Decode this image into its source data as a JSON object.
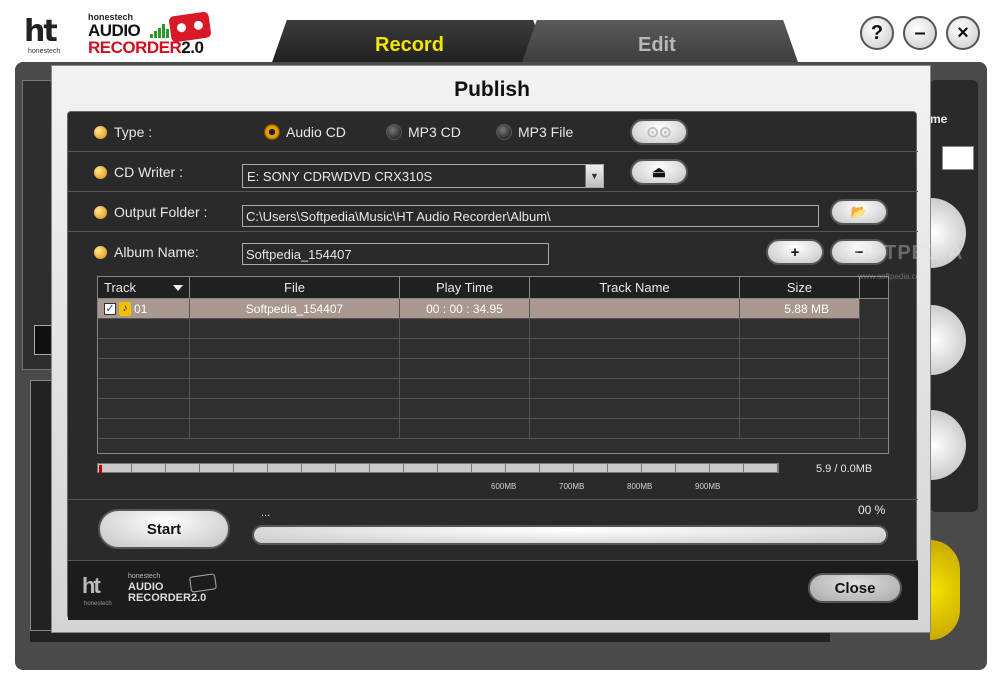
{
  "app": {
    "brand": "honestech",
    "logo_mark": "ht",
    "logo_sub": "honestech",
    "name_line1": "AUDIO",
    "name_line2": "RECORDER",
    "version": "2.0"
  },
  "tabs": [
    {
      "label": "Record",
      "active": true
    },
    {
      "label": "Edit",
      "active": false
    }
  ],
  "window_buttons": {
    "help": "?",
    "minimize": "–",
    "close": "×"
  },
  "background": {
    "volume_label": "me"
  },
  "dialog": {
    "title": "Publish",
    "type_label": "Type :",
    "type_options": [
      {
        "label": "Audio CD",
        "selected": true
      },
      {
        "label": "MP3 CD",
        "selected": false
      },
      {
        "label": "MP3 File",
        "selected": false
      }
    ],
    "cd_writer_label": "CD Writer :",
    "cd_writer_value": "E: SONY     CDRWDVD CRX310S",
    "output_folder_label": "Output  Folder :",
    "output_folder_value": "C:\\Users\\Softpedia\\Music\\HT Audio Recorder\\Album\\",
    "album_name_label": "Album Name:",
    "album_name_value": "Softpedia_154407",
    "buttons": {
      "burn": "⊙⊙",
      "eject": "⏏",
      "browse": "📂",
      "add": "+",
      "remove": "−"
    },
    "table": {
      "columns": [
        "Track",
        "File",
        "Play Time",
        "Track Name",
        "Size"
      ],
      "rows": [
        {
          "track": "01",
          "file": "Softpedia_154407",
          "play_time": "00 : 00 : 34.95",
          "track_name": "",
          "size": "5.88 MB",
          "checked": true
        }
      ],
      "empty_rows": 6
    },
    "capacity": {
      "used_fraction": 0.004,
      "ticks": [
        "600MB",
        "700MB",
        "800MB",
        "900MB"
      ],
      "text": "5.9 /  0.0MB"
    },
    "start_label": "Start",
    "status_text": "...",
    "progress_percent": 0,
    "progress_text": "00 %",
    "close_label": "Close"
  },
  "watermark": {
    "text": "SOFTPEDIA",
    "sub": "www.softpedia.com"
  },
  "colors": {
    "accent_yellow": "#f4e400",
    "bullet_orange": "#f0a400",
    "brand_red": "#d01020",
    "dark_panel": "#2a2a2a"
  }
}
